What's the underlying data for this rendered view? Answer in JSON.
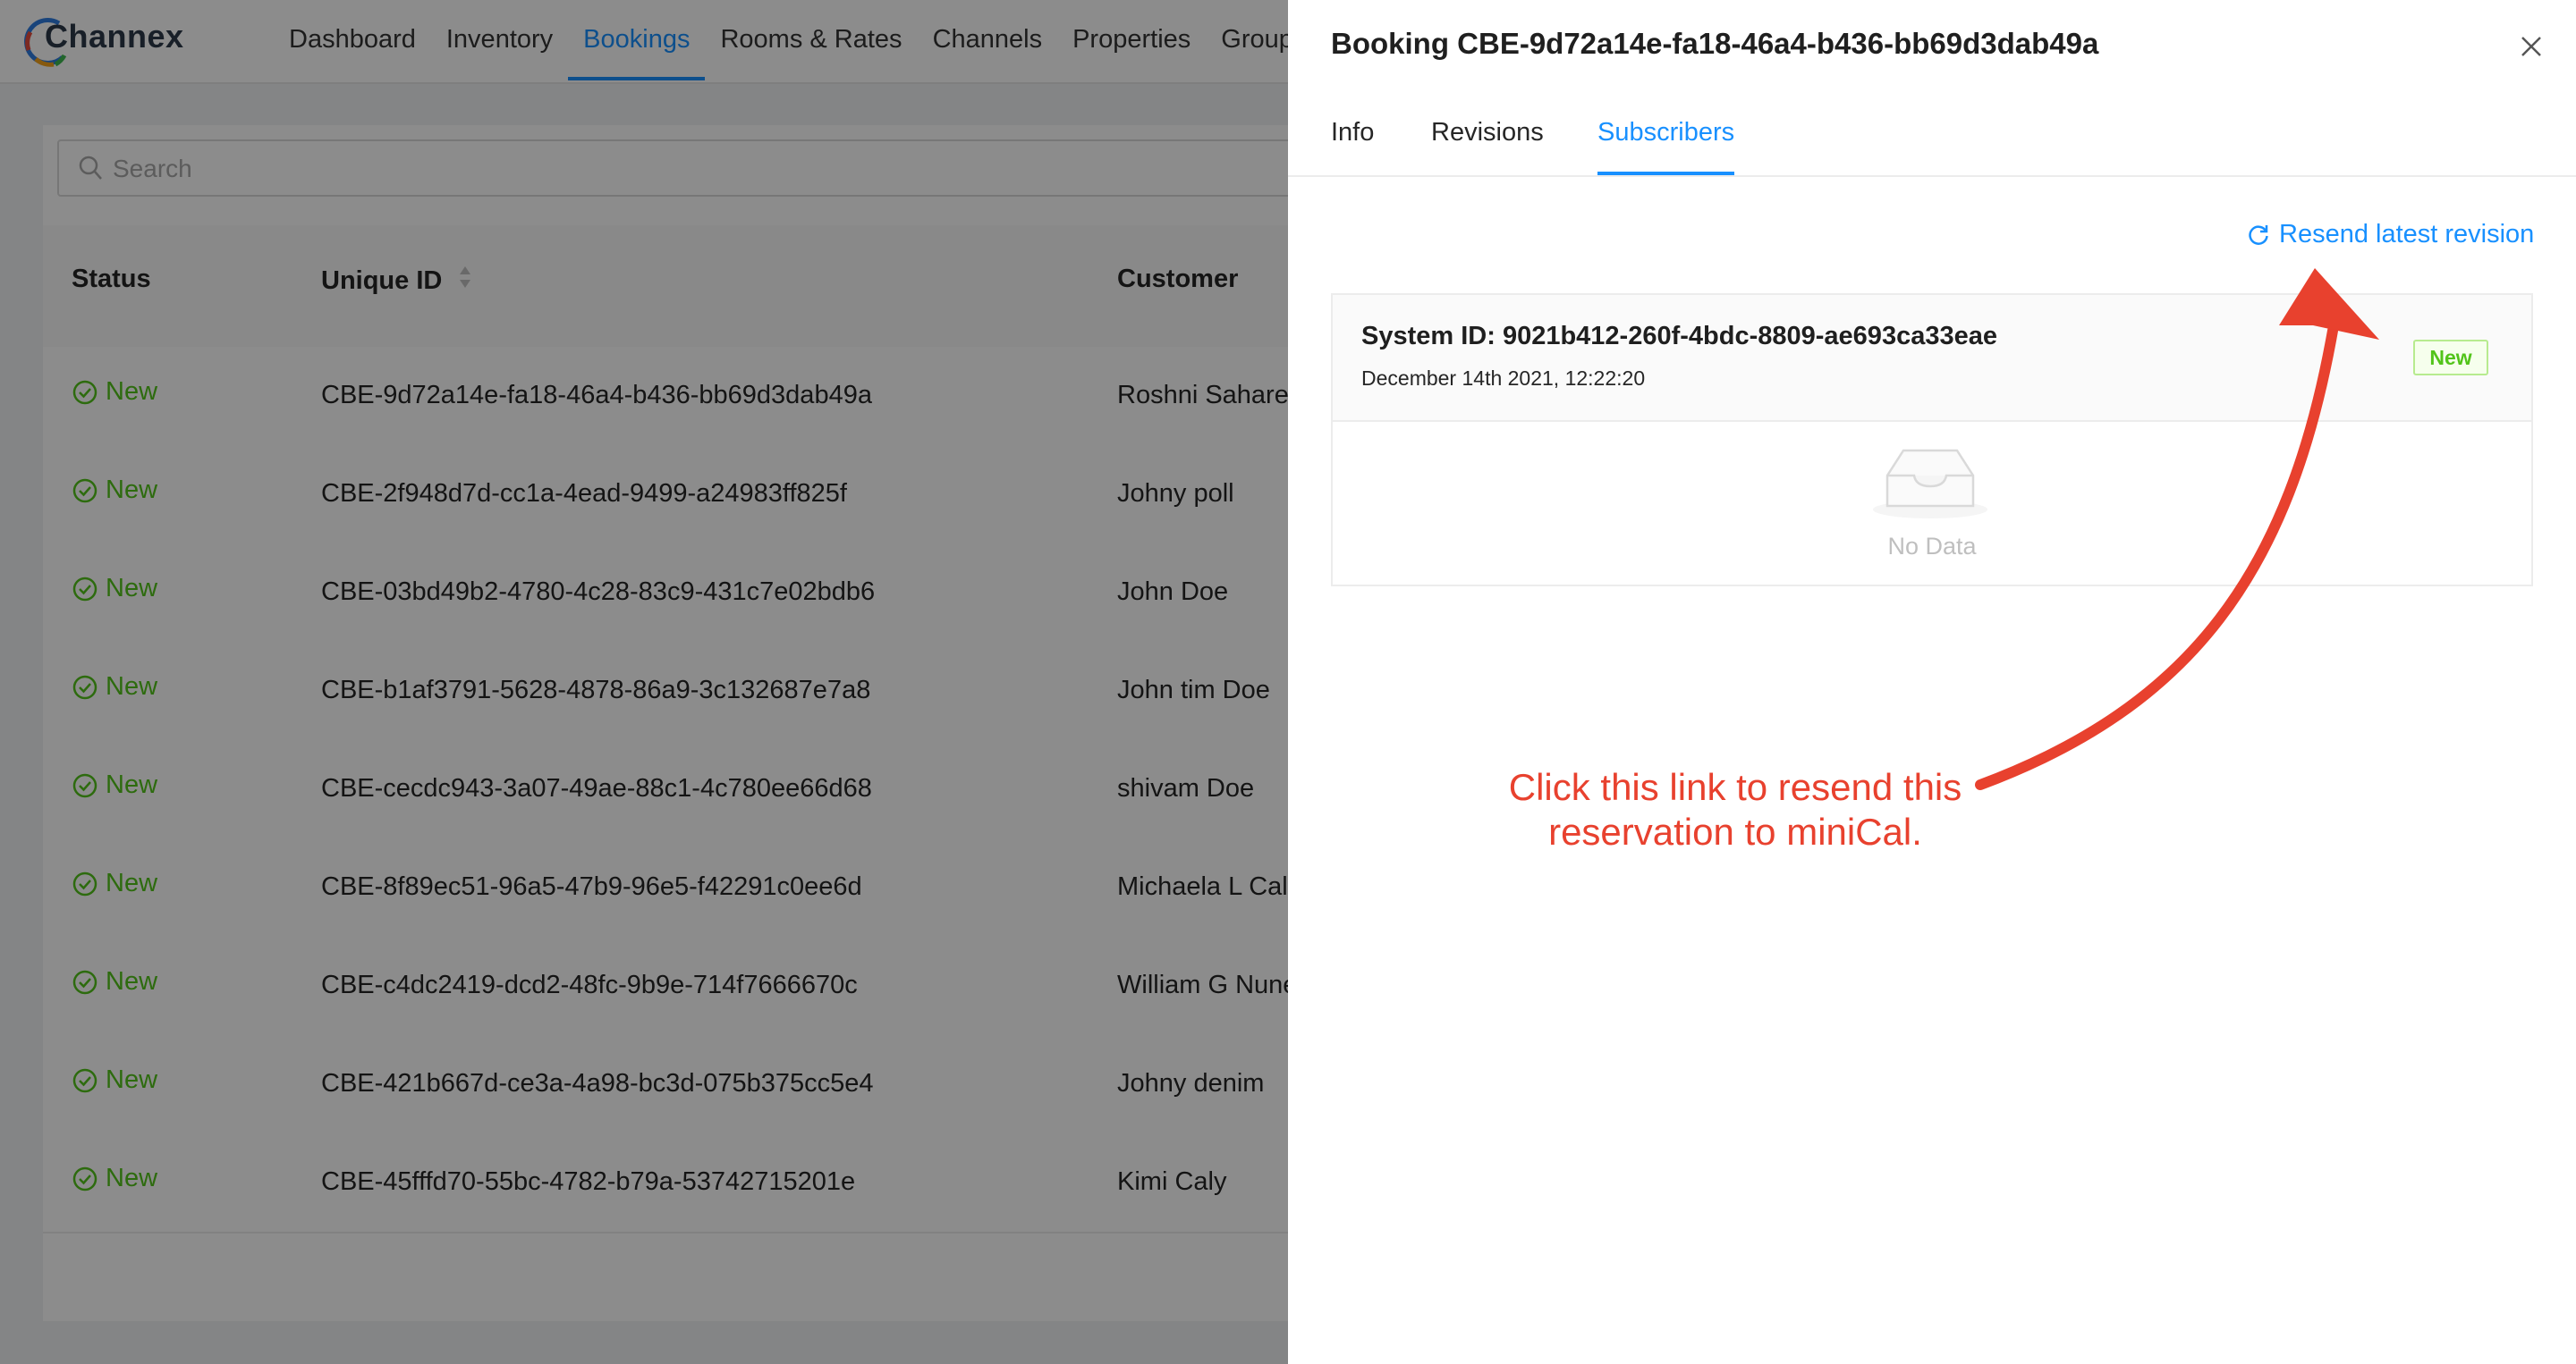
{
  "app": {
    "logo_text": "Channex",
    "nav": [
      "Dashboard",
      "Inventory",
      "Bookings",
      "Rooms & Rates",
      "Channels",
      "Properties",
      "Group"
    ],
    "active_nav": "Bookings"
  },
  "search": {
    "placeholder": "Search"
  },
  "table": {
    "headers": {
      "status": "Status",
      "unique_id": "Unique ID",
      "customer": "Customer"
    },
    "rows": [
      {
        "status": "New",
        "uid": "CBE-9d72a14e-fa18-46a4-b436-bb69d3dab49a",
        "customer": "Roshni Sahare"
      },
      {
        "status": "New",
        "uid": "CBE-2f948d7d-cc1a-4ead-9499-a24983ff825f",
        "customer": "Johny poll"
      },
      {
        "status": "New",
        "uid": "CBE-03bd49b2-4780-4c28-83c9-431c7e02bdb6",
        "customer": "John Doe"
      },
      {
        "status": "New",
        "uid": "CBE-b1af3791-5628-4878-86a9-3c132687e7a8",
        "customer": "John tim Doe"
      },
      {
        "status": "New",
        "uid": "CBE-cecdc943-3a07-49ae-88c1-4c780ee66d68",
        "customer": "shivam Doe"
      },
      {
        "status": "New",
        "uid": "CBE-8f89ec51-96a5-47b9-96e5-f42291c0ee6d",
        "customer": "Michaela L Call"
      },
      {
        "status": "New",
        "uid": "CBE-c4dc2419-dcd2-48fc-9b9e-714f7666670c",
        "customer": "William G Nune"
      },
      {
        "status": "New",
        "uid": "CBE-421b667d-ce3a-4a98-bc3d-075b375cc5e4",
        "customer": "Johny denim"
      },
      {
        "status": "New",
        "uid": "CBE-45fffd70-55bc-4782-b79a-53742715201e",
        "customer": "Kimi Caly"
      }
    ]
  },
  "drawer": {
    "title": "Booking CBE-9d72a14e-fa18-46a4-b436-bb69d3dab49a",
    "tabs": [
      "Info",
      "Revisions",
      "Subscribers"
    ],
    "active_tab": "Subscribers",
    "resend_label": "Resend latest revision",
    "subscriber": {
      "system_id": "System ID: 9021b412-260f-4bdc-8809-ae693ca33eae",
      "date": "December 14th 2021, 12:22:20",
      "badge": "New",
      "empty_text": "No Data"
    }
  },
  "annotation": {
    "line1": "Click this link to resend this",
    "line2": "reservation to miniCal.",
    "color": "#e8412e"
  },
  "colors": {
    "accent": "#1890ff",
    "status_green": "#52c41a",
    "overlay": "rgba(0,0,0,0.45)"
  }
}
